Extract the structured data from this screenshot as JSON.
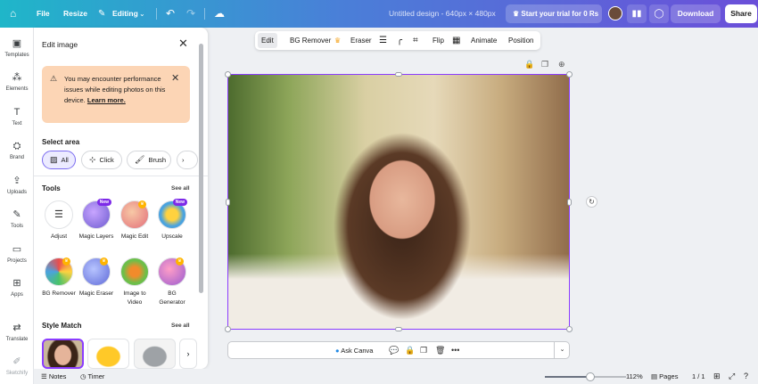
{
  "topbar": {
    "file": "File",
    "resize": "Resize",
    "editing": "Editing",
    "title": "Untitled design - 640px × 480px",
    "trial": "Start your trial for 0 Rs",
    "download": "Download",
    "share": "Share"
  },
  "rail": [
    {
      "label": "Templates",
      "icon": "templates-icon"
    },
    {
      "label": "Elements",
      "icon": "elements-icon"
    },
    {
      "label": "Text",
      "icon": "text-icon"
    },
    {
      "label": "Brand",
      "icon": "brand-icon"
    },
    {
      "label": "Uploads",
      "icon": "uploads-icon"
    },
    {
      "label": "Tools",
      "icon": "tools-icon"
    },
    {
      "label": "Projects",
      "icon": "projects-icon"
    },
    {
      "label": "Apps",
      "icon": "apps-icon"
    },
    {
      "label": "Translate",
      "icon": "translate-icon"
    },
    {
      "label": "Sketchify",
      "icon": "sketchify-icon"
    }
  ],
  "panel": {
    "title": "Edit image",
    "warning": {
      "text": "You may encounter performance issues while editing photos on this device.",
      "link": "Learn more."
    },
    "select_area": {
      "title": "Select area",
      "options": [
        "All",
        "Click",
        "Brush"
      ]
    },
    "tools": {
      "title": "Tools",
      "see_all": "See all",
      "items": [
        {
          "label": "Adjust",
          "badge": ""
        },
        {
          "label": "Magic Layers",
          "badge": "New"
        },
        {
          "label": "Magic Edit",
          "badge": ""
        },
        {
          "label": "Upscale",
          "badge": "New"
        },
        {
          "label": "BG Remover",
          "badge": ""
        },
        {
          "label": "Magic Eraser",
          "badge": ""
        },
        {
          "label": "Image to Video",
          "badge": ""
        },
        {
          "label": "BG Generator",
          "badge": ""
        }
      ]
    },
    "style_match": {
      "title": "Style Match",
      "see_all": "See all"
    }
  },
  "context_toolbar": {
    "edit": "Edit",
    "bg_remover": "BG Remover",
    "eraser": "Eraser",
    "flip": "Flip",
    "animate": "Animate",
    "position": "Position"
  },
  "ask_bar": {
    "label": "Ask Canva"
  },
  "bottombar": {
    "notes": "Notes",
    "timer": "Timer",
    "zoom": "112%",
    "zoom_fraction": 0.56,
    "pages": "Pages",
    "page_count": "1 / 1"
  },
  "colors": {
    "accent": "#8b3dff",
    "warning_bg": "#fcd5b5",
    "new_badge": "#7d2ae8"
  }
}
